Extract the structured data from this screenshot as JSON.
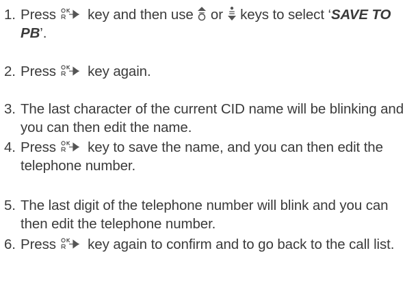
{
  "icons": {
    "ok": "ok-r-arrow-icon",
    "up": "scroll-up-icon",
    "down": "scroll-down-icon"
  },
  "steps": [
    {
      "num": "1.",
      "a": "Press",
      "b": "key and then use",
      "c": "or",
      "d": "keys to select ‘",
      "e": "SAVE TO PB",
      "f": "’."
    },
    {
      "num": "2.",
      "a": "Press",
      "b": "key again."
    },
    {
      "num": "3.",
      "a": "The last character of the current CID name will be blinking and you can then edit the name."
    },
    {
      "num": "4.",
      "a": "Press",
      "b": "key to save the name, and you can then edit the telephone number."
    },
    {
      "num": "5.",
      "a": "The last digit of the telephone number will blink and you can then edit the telephone number."
    },
    {
      "num": "6.",
      "a": "Press",
      "b": "key again to confirm and to go back to the call list."
    }
  ]
}
